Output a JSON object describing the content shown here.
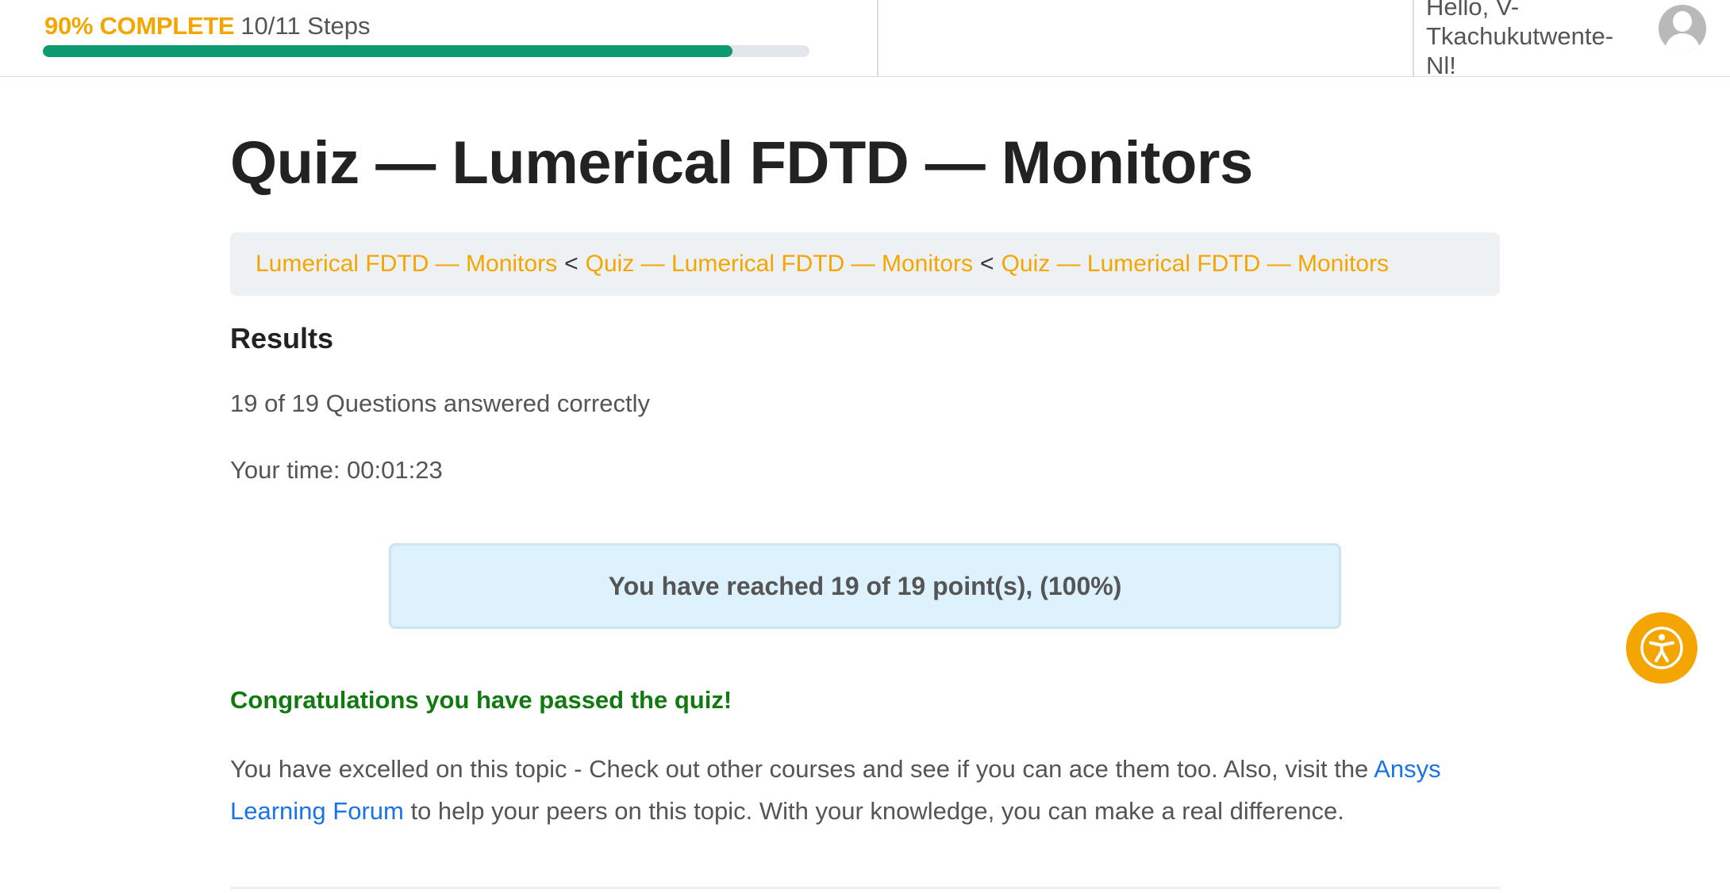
{
  "header": {
    "progress": {
      "percent_label": "90% COMPLETE",
      "steps_label": "10/11 Steps",
      "fraction": 0.9,
      "fill_color": "#0e9a6f",
      "track_color": "#e3e6ea"
    },
    "greeting": "Hello, V-Tkachukutwente-Nl!",
    "avatar_icon": "user-avatar-icon"
  },
  "page": {
    "title": "Quiz — Lumerical FDTD — Monitors"
  },
  "breadcrumb": {
    "items": [
      {
        "label": "Lumerical FDTD — Monitors"
      },
      {
        "label": "Quiz — Lumerical FDTD — Monitors"
      },
      {
        "label": "Quiz — Lumerical FDTD — Monitors"
      }
    ],
    "separator": "<",
    "link_color": "#f5a500"
  },
  "results": {
    "heading": "Results",
    "correct_line": "19 of 19 Questions answered correctly",
    "time_line": "Your time: 00:01:23",
    "points_line": "You have reached 19 of 19 point(s), (100%)",
    "congrats": "Congratulations you have passed the quiz!",
    "message_before": "You have excelled on this topic - Check out other courses and see if you can ace them too. Also, visit the ",
    "message_link": "Ansys Learning Forum",
    "message_after": " to help your peers on this topic. With your knowledge, you can make a real difference.",
    "congrats_color": "#107a10",
    "link_color": "#1a73e8"
  },
  "accessibility": {
    "icon": "accessibility-icon",
    "color": "#f5a500"
  }
}
